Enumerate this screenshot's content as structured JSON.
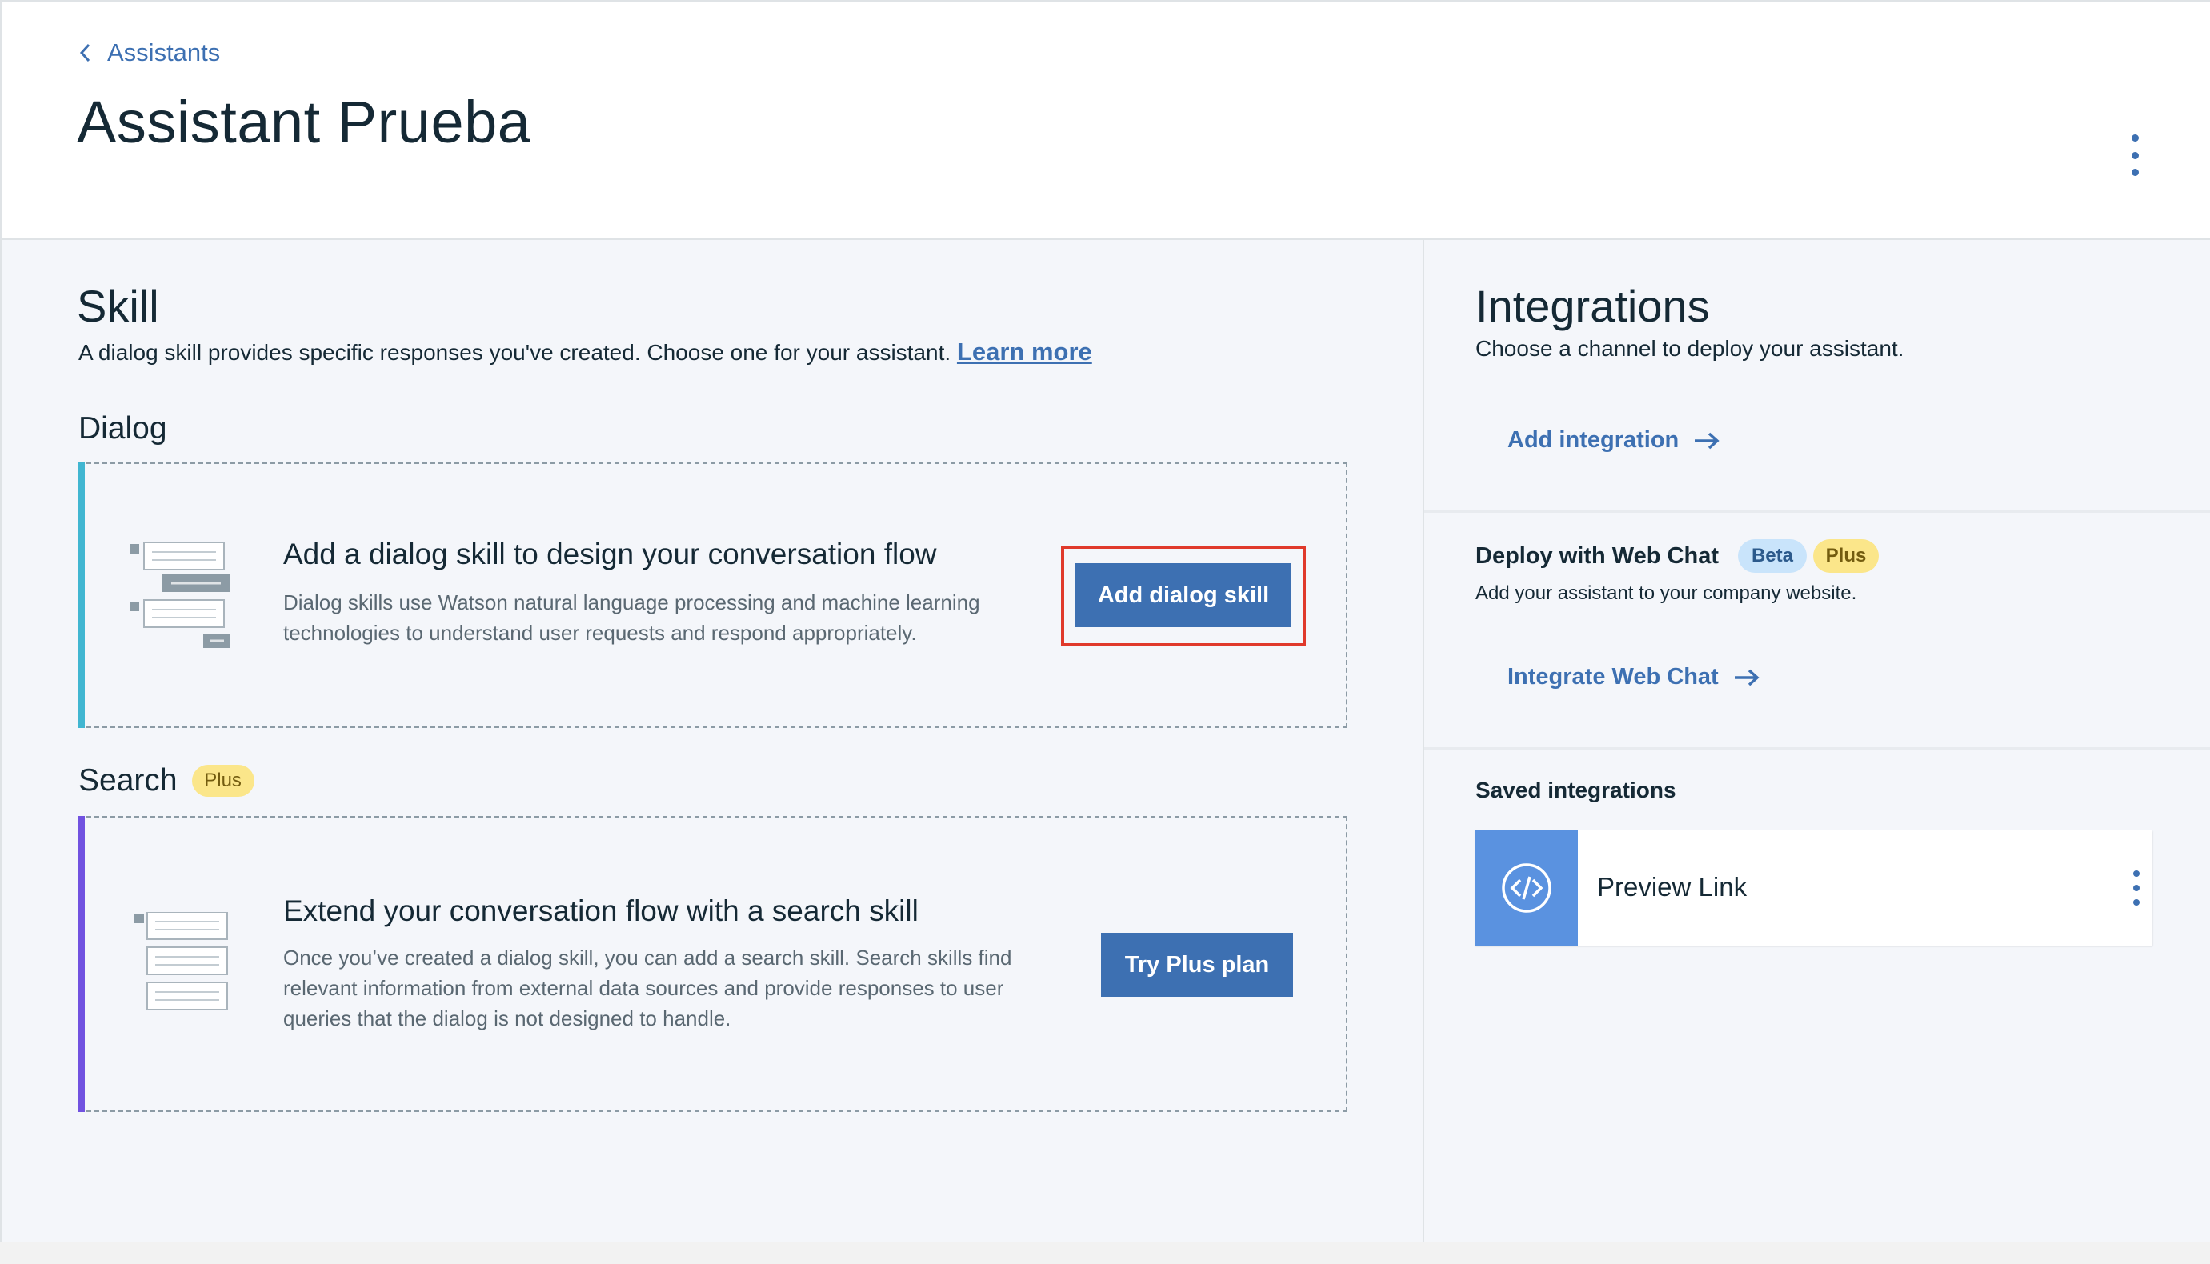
{
  "header": {
    "breadcrumb": "Assistants",
    "title": "Assistant Prueba"
  },
  "skill": {
    "title": "Skill",
    "description": "A dialog skill provides specific responses you've created. Choose one for your assistant.",
    "learn_more": "Learn more",
    "dialog": {
      "section_label": "Dialog",
      "card_heading": "Add a dialog skill to design your conversation flow",
      "card_text": "Dialog skills use Watson natural language processing and machine learning technologies to understand user requests and respond appropriately.",
      "button": "Add dialog skill"
    },
    "search": {
      "section_label": "Search",
      "tag": "Plus",
      "card_heading": "Extend your conversation flow with a search skill",
      "card_text": "Once you’ve created a dialog skill, you can add a search skill. Search skills find relevant information from external data sources and provide responses to user queries that the dialog is not designed to handle.",
      "button": "Try Plus plan"
    }
  },
  "integrations": {
    "title": "Integrations",
    "description": "Choose a channel to deploy your assistant.",
    "add_link": "Add integration",
    "web_chat": {
      "title": "Deploy with Web Chat",
      "beta_tag": "Beta",
      "plus_tag": "Plus",
      "description": "Add your assistant to your company website.",
      "link": "Integrate Web Chat"
    },
    "saved": {
      "title": "Saved integrations",
      "items": [
        {
          "name": "Preview Link",
          "icon": "code-icon"
        }
      ]
    }
  },
  "colors": {
    "accent": "#3d70b2",
    "dialog_accent": "#41b6d1",
    "search_accent": "#7152e0",
    "highlight": "#e0392b",
    "plus_tag": "#fbe68a",
    "beta_tag": "#c9e4fb",
    "preview_icon_bg": "#5a92e0"
  }
}
